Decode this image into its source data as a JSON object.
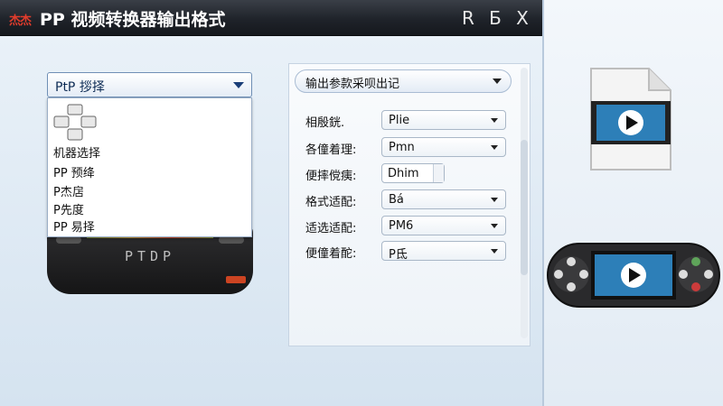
{
  "app": {
    "logo_text": "杰杰",
    "title": "PP  视频转换器输出格式",
    "controls": {
      "restore": "R",
      "minimize": "Б",
      "close": "X"
    }
  },
  "left_panel": {
    "select_value": "PtP  拶择",
    "list_items": [
      "机器选择",
      "PP 预绛",
      "P杰扂",
      "P先度",
      "PP 易择"
    ],
    "device_label": "PTDP"
  },
  "settings": {
    "header": "输出参款采呗出记",
    "rows": [
      {
        "label": "相殷銧.",
        "value": "Plie",
        "kind": "combo"
      },
      {
        "label": "各僮着理:",
        "value": "Pmn",
        "kind": "combo"
      },
      {
        "label": "便摔傥痍:",
        "value": "Dhim",
        "kind": "field"
      },
      {
        "label": "格式适配:",
        "value": "Bá",
        "kind": "combo"
      },
      {
        "label": "适选适配:",
        "value": "PM6",
        "kind": "combo"
      },
      {
        "label": "便僮着酡:",
        "value": "P氐",
        "kind": "combo"
      }
    ]
  },
  "right_icons": {
    "video_file": "video-file-icon",
    "console": "console-icon"
  },
  "colors": {
    "titlebar": "#1f232a",
    "accent": "#1a3e78",
    "background": "#dfe9f3"
  }
}
